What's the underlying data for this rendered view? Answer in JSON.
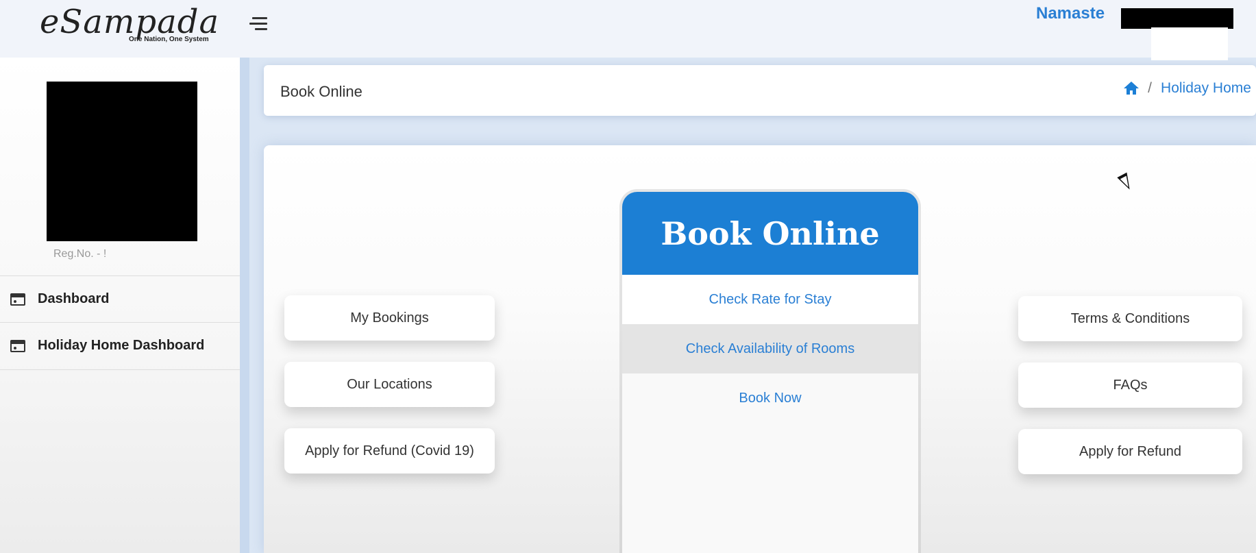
{
  "header": {
    "logo_text": "eSampada",
    "logo_tagline": "One Nation, One System",
    "greeting": "Namaste"
  },
  "sidebar": {
    "reg_no": "Reg.No. - !",
    "items": [
      {
        "label": "Dashboard",
        "icon": "dashboard-icon"
      },
      {
        "label": "Holiday Home Dashboard",
        "icon": "dashboard-icon"
      }
    ]
  },
  "page": {
    "title": "Book Online",
    "breadcrumb_home_icon": "home-icon",
    "breadcrumb_current": "Holiday Home"
  },
  "left_actions": [
    "My Bookings",
    "Our Locations",
    "Apply for Refund (Covid 19)"
  ],
  "right_actions": [
    "Terms & Conditions",
    "FAQs",
    "Apply for Refund"
  ],
  "book_card": {
    "title": "Book Online",
    "options": [
      "Check Rate for Stay",
      "Check Availability of Rooms",
      "Book Now"
    ]
  },
  "colors": {
    "brand_blue": "#1c7fd4",
    "link_blue": "#2a7fd4",
    "background": "#dbe6f4"
  }
}
